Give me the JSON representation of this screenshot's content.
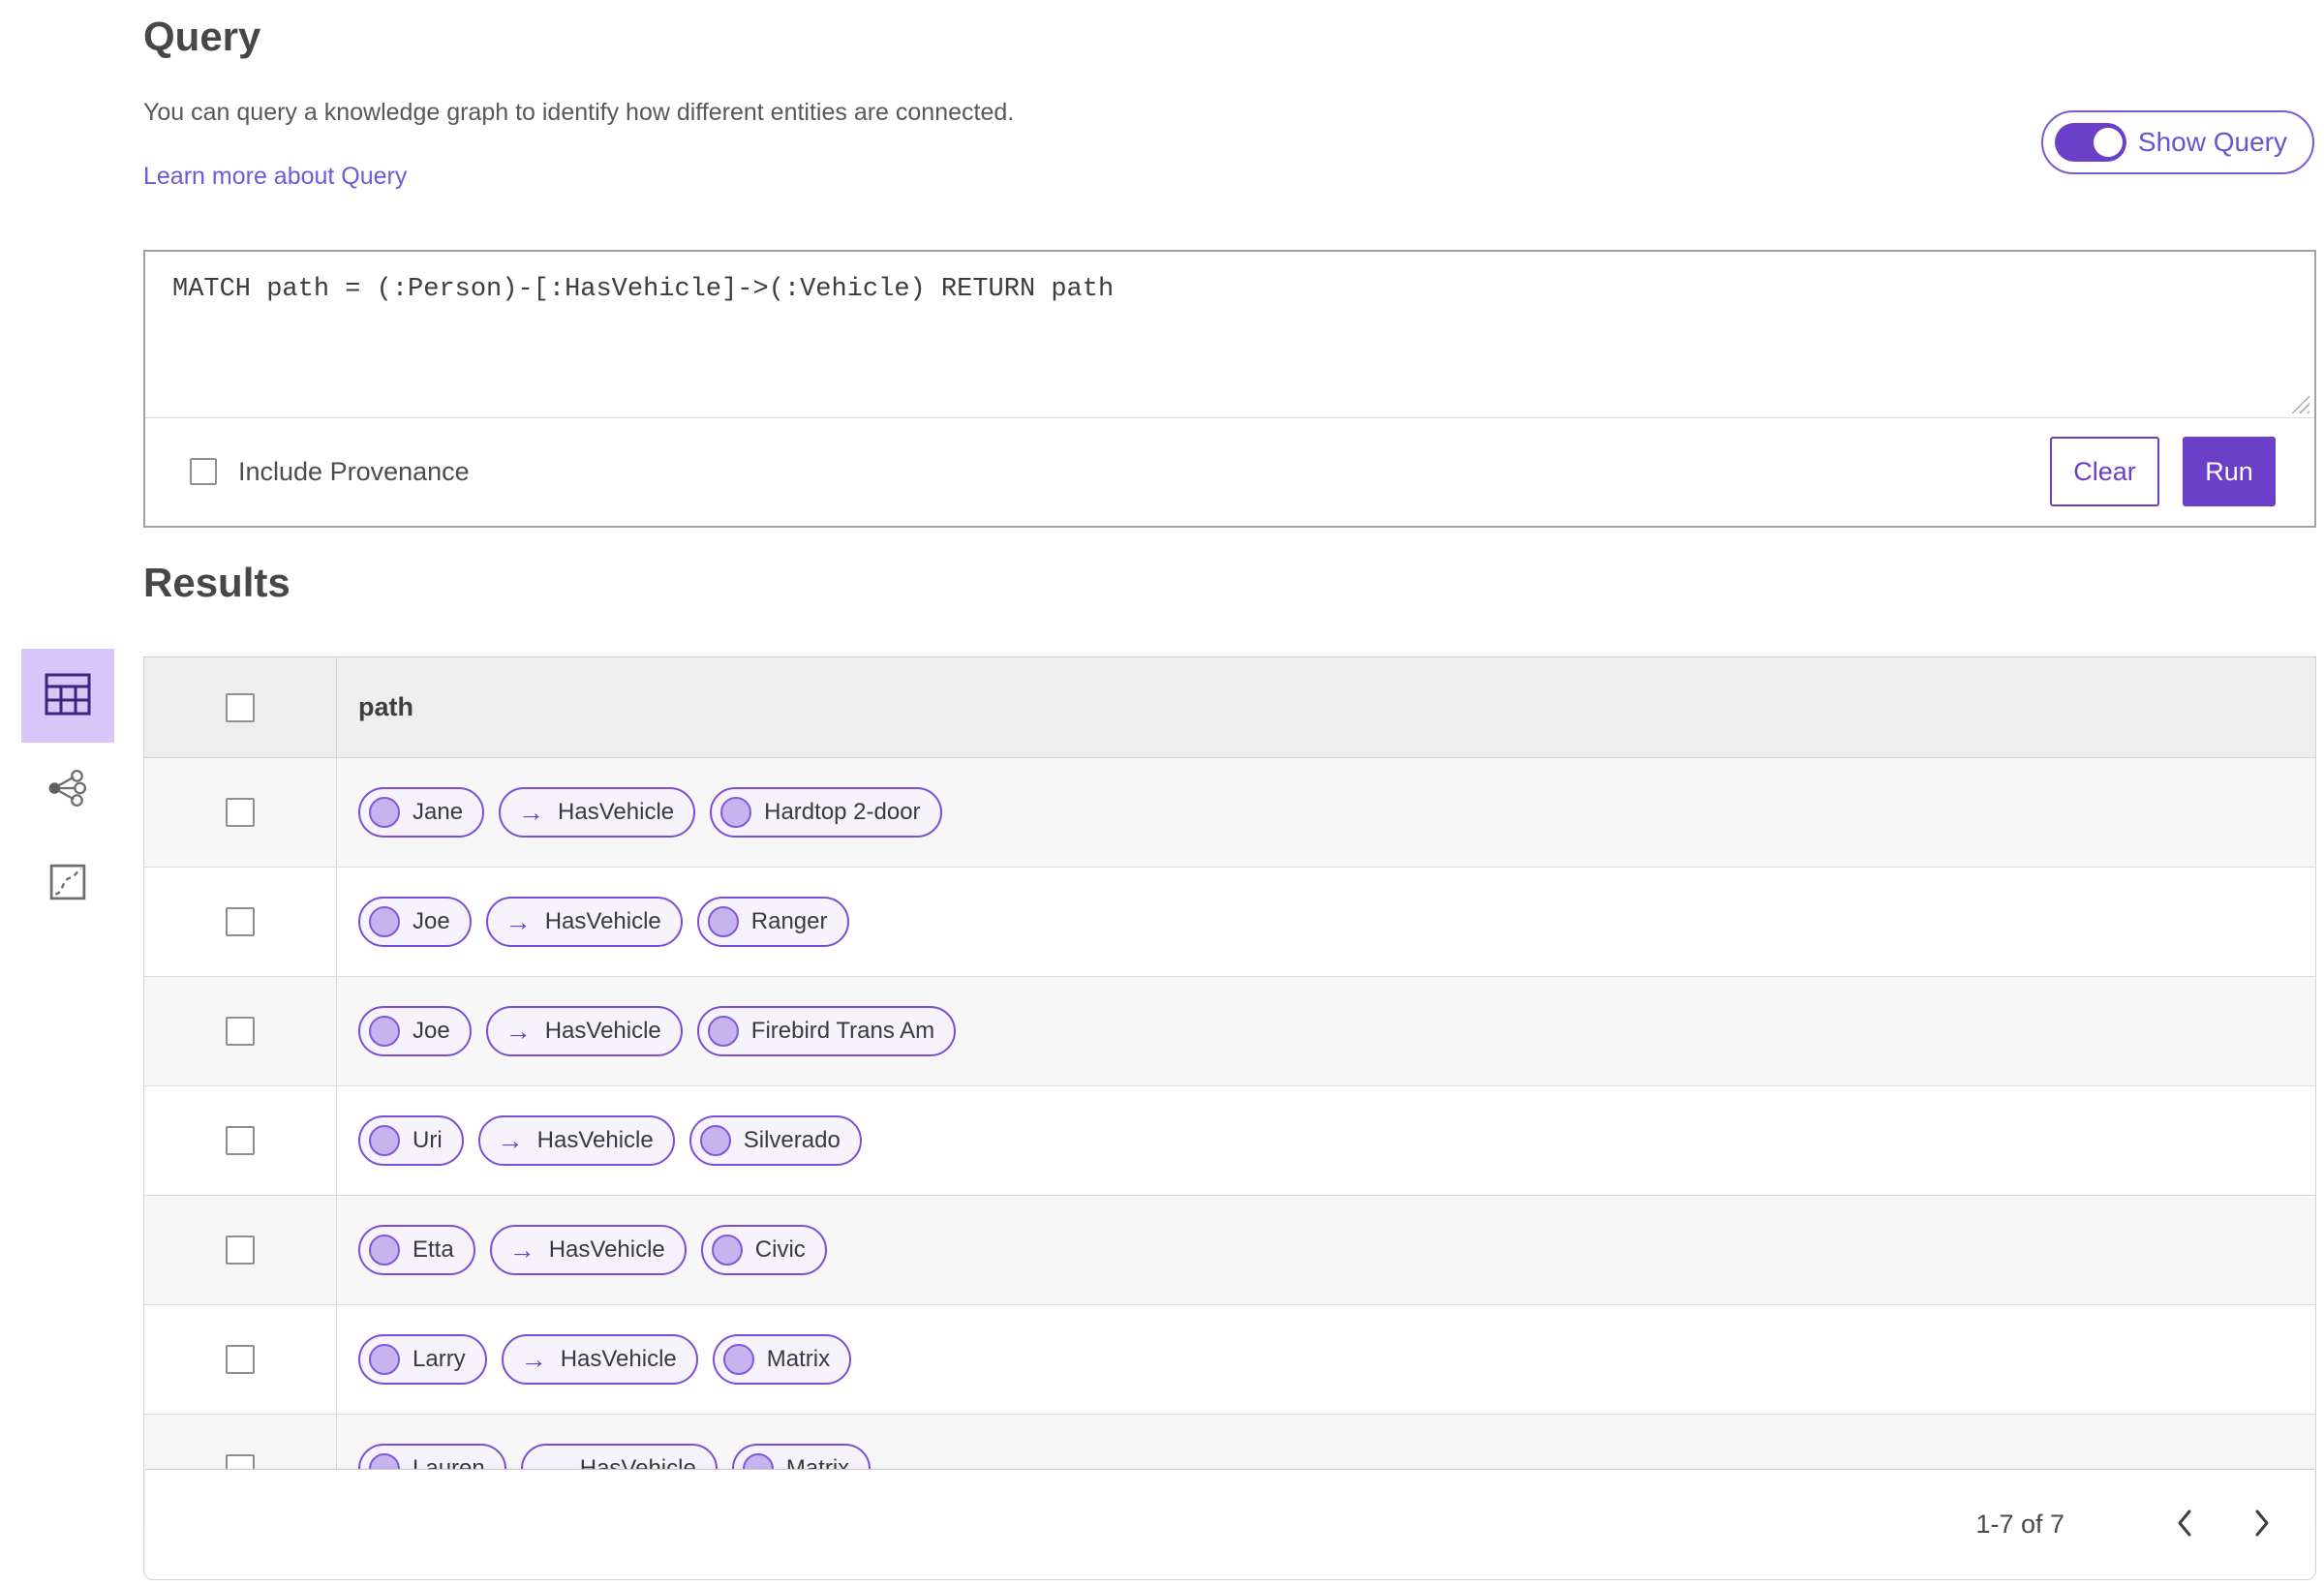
{
  "page": {
    "title": "Query",
    "description": "You can query a knowledge graph to identify how different entities are connected.",
    "learn_more_link": "Learn more about Query",
    "show_query_label": "Show Query",
    "show_query_on": true
  },
  "query_panel": {
    "query_text": "MATCH path = (:Person)-[:HasVehicle]->(:Vehicle) RETURN path",
    "include_provenance_label": "Include Provenance",
    "include_provenance_checked": false,
    "clear_label": "Clear",
    "run_label": "Run"
  },
  "results": {
    "title": "Results",
    "view_icons": [
      {
        "name": "table-view-icon",
        "selected": true
      },
      {
        "name": "link-chart-view-icon",
        "selected": false
      },
      {
        "name": "map-view-icon",
        "selected": false
      }
    ],
    "table": {
      "column_header": "path",
      "select_all_checked": false,
      "relation_arrow": "→",
      "rows": [
        {
          "source": "Jane",
          "relation": "HasVehicle",
          "target": "Hardtop 2-door"
        },
        {
          "source": "Joe",
          "relation": "HasVehicle",
          "target": "Ranger"
        },
        {
          "source": "Joe",
          "relation": "HasVehicle",
          "target": "Firebird Trans Am"
        },
        {
          "source": "Uri",
          "relation": "HasVehicle",
          "target": "Silverado"
        },
        {
          "source": "Etta",
          "relation": "HasVehicle",
          "target": "Civic"
        },
        {
          "source": "Larry",
          "relation": "HasVehicle",
          "target": "Matrix"
        },
        {
          "source": "Lauren",
          "relation": "HasVehicle",
          "target": "Matrix"
        }
      ]
    },
    "pagination": {
      "range_label": "1-7 of 7",
      "prev_icon": "chevron-left-icon",
      "next_icon": "chevron-right-icon"
    }
  },
  "colors": {
    "accent": "#6b3fc8",
    "pill_border": "#7a4fd6",
    "pill_bg": "#f6f3fd",
    "node_fill": "#c7b4ee",
    "selected_view_bg": "#d9c6f8",
    "link": "#6f58d8",
    "header_row_bg": "#eeeeee",
    "stripe_row_bg": "#f7f7f7"
  }
}
